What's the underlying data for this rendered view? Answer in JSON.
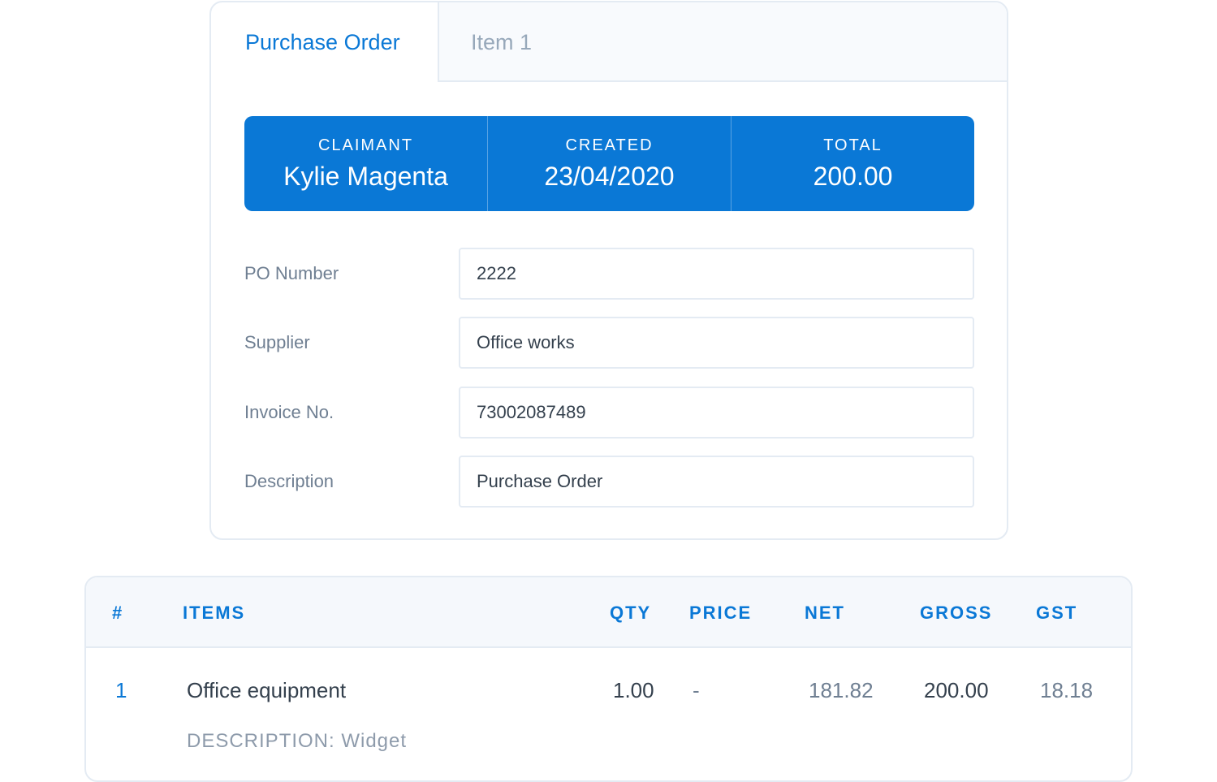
{
  "tabs": [
    {
      "label": "Purchase Order",
      "active": true
    },
    {
      "label": "Item 1",
      "active": false
    }
  ],
  "summary": {
    "claimant": {
      "label": "CLAIMANT",
      "value": "Kylie Magenta"
    },
    "created": {
      "label": "CREATED",
      "value": "23/04/2020"
    },
    "total": {
      "label": "TOTAL",
      "value": "200.00"
    }
  },
  "form": {
    "po_number": {
      "label": "PO Number",
      "value": "2222"
    },
    "supplier": {
      "label": "Supplier",
      "value": "Office works"
    },
    "invoice_no": {
      "label": "Invoice No.",
      "value": "73002087489"
    },
    "description": {
      "label": "Description",
      "value": "Purchase Order"
    }
  },
  "items_table": {
    "headers": {
      "num": "#",
      "items": "ITEMS",
      "qty": "QTY",
      "price": "PRICE",
      "net": "NET",
      "gross": "GROSS",
      "gst": "GST"
    },
    "rows": [
      {
        "num": "1",
        "name": "Office equipment",
        "description": "DESCRIPTION: Widget",
        "qty": "1.00",
        "price": "-",
        "net": "181.82",
        "gross": "200.00",
        "gst": "18.18"
      }
    ]
  },
  "colors": {
    "accent": "#0a78d6",
    "border": "#e4ebf3",
    "muted_text": "#6f7f92",
    "body_text": "#34404d"
  }
}
